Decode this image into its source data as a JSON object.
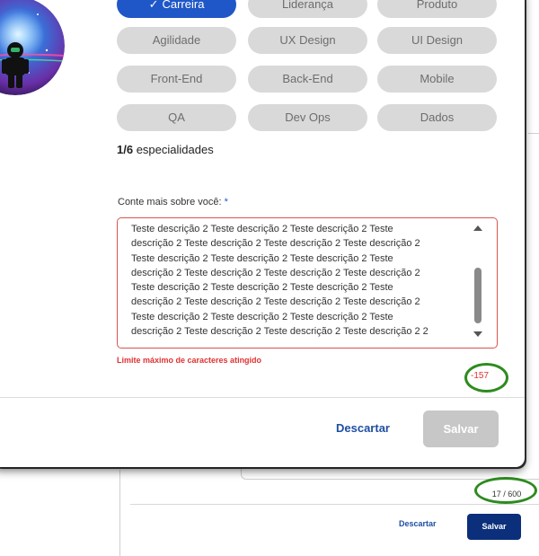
{
  "background_page": {
    "counter": "17 / 600",
    "discard_label": "Descartar",
    "save_label": "Salvar"
  },
  "modal": {
    "specialties": [
      {
        "label": "Carreira",
        "selected": true
      },
      {
        "label": "Liderança",
        "selected": false
      },
      {
        "label": "Produto",
        "selected": false
      },
      {
        "label": "Agilidade",
        "selected": false
      },
      {
        "label": "UX Design",
        "selected": false
      },
      {
        "label": "UI Design",
        "selected": false
      },
      {
        "label": "Front-End",
        "selected": false
      },
      {
        "label": "Back-End",
        "selected": false
      },
      {
        "label": "Mobile",
        "selected": false
      },
      {
        "label": "QA",
        "selected": false
      },
      {
        "label": "Dev Ops",
        "selected": false
      },
      {
        "label": "Dados",
        "selected": false
      }
    ],
    "selected_count": "1/6",
    "selected_count_suffix": " especialidades",
    "about_label": "Conte mais sobre você:",
    "about_required": " *",
    "about_value": "Teste descrição 2 Teste descrição 2 Teste descrição 2 Teste\ndescrição 2 Teste descrição 2 Teste descrição 2 Teste descrição 2\nTeste descrição 2 Teste descrição 2 Teste descrição 2 Teste\ndescrição 2 Teste descrição 2 Teste descrição 2 Teste descrição 2\nTeste descrição 2 Teste descrição 2 Teste descrição 2 Teste\ndescrição 2 Teste descrição 2 Teste descrição 2 Teste descrição 2\nTeste descrição 2 Teste descrição 2 Teste descrição 2 Teste\ndescrição 2 Teste descrição 2 Teste descrição 2 Teste descrição 2 2",
    "error_message": "Limite máximo de caracteres atingido",
    "char_counter": "-157",
    "discard_label": "Descartar",
    "save_label": "Salvar"
  },
  "colors": {
    "accent": "#1f57c8",
    "error": "#e03131",
    "annotation_ring": "#2e8b1f",
    "chip_bg": "#d9d9d9",
    "save_disabled": "#c7c7c7",
    "bg_save": "#0b2f7a"
  }
}
